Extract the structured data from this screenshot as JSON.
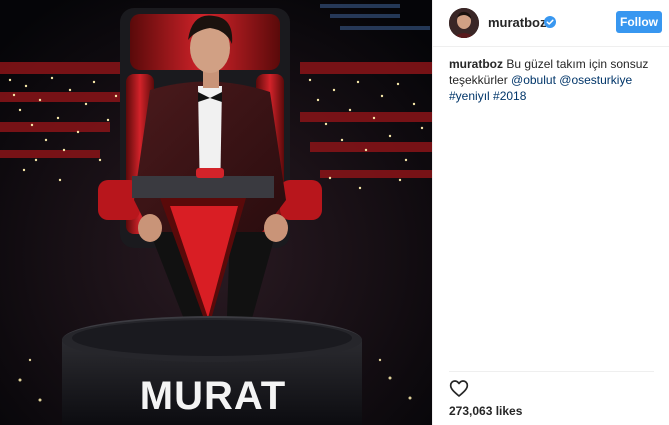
{
  "post": {
    "username": "muratboz",
    "follow_label": "Follow",
    "caption_user": "muratboz",
    "caption_text": " Bu güzel takım için sonsuz teşekkürler ",
    "mention1": "@obulut",
    "mention2": "@osesturkiye",
    "tag1": "#yeniyıl",
    "tag2": "#2018",
    "likes": "273,063 likes"
  },
  "photo": {
    "nameplate": "MURAT"
  },
  "icons": {
    "verified": "verified-badge-icon",
    "heart": "heart-icon"
  },
  "colors": {
    "follow_button": "#3897f0",
    "link": "#003569",
    "chair_red": "#c1121f"
  }
}
